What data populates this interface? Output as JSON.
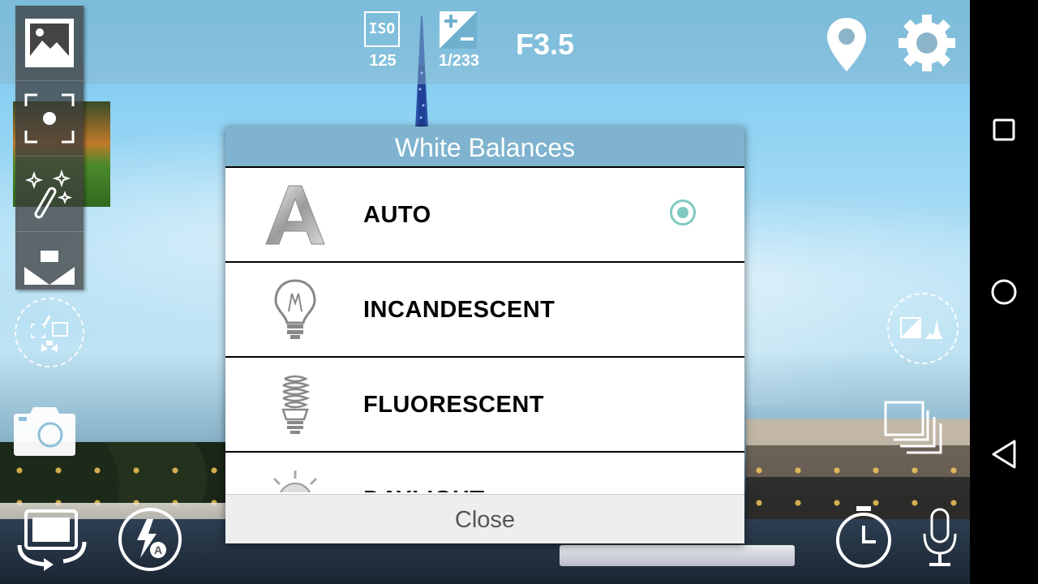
{
  "topbar": {
    "iso_label": "ISO",
    "iso_value": "125",
    "shutter_value": "1/233",
    "aperture": "F3.5"
  },
  "dialog": {
    "title": "White Balances",
    "items": [
      {
        "label": "AUTO",
        "icon": "auto-a-icon",
        "selected": true
      },
      {
        "label": "INCANDESCENT",
        "icon": "incandescent-bulb-icon",
        "selected": false
      },
      {
        "label": "FLUORESCENT",
        "icon": "fluorescent-bulb-icon",
        "selected": false
      },
      {
        "label": "DAYLIGHT",
        "icon": "daylight-sun-icon",
        "selected": false
      }
    ],
    "close_label": "Close"
  },
  "side_menu": [
    "gallery-icon",
    "focus-icon",
    "magic-wand-icon",
    "scene-mode-icon"
  ],
  "colors": {
    "dialog_title_bg": "#7fb3cf",
    "radio_accent": "#7fc9c0"
  }
}
